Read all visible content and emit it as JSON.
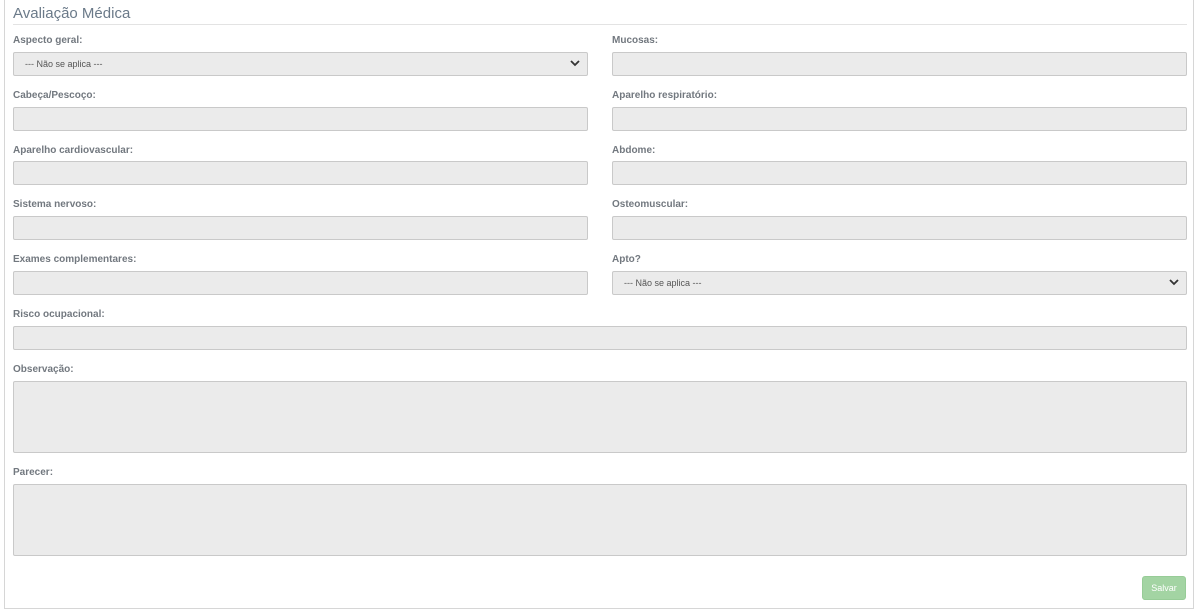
{
  "form": {
    "title": "Avaliação Médica",
    "fields": {
      "aspecto_geral": {
        "label": "Aspecto geral:",
        "value": "--- Não se aplica ---"
      },
      "mucosas": {
        "label": "Mucosas:",
        "value": ""
      },
      "cabeca_pescoco": {
        "label": "Cabeça/Pescoço:",
        "value": ""
      },
      "aparelho_respiratorio": {
        "label": "Aparelho respiratório:",
        "value": ""
      },
      "aparelho_cardiovascular": {
        "label": "Aparelho cardiovascular:",
        "value": ""
      },
      "abdome": {
        "label": "Abdome:",
        "value": ""
      },
      "sistema_nervoso": {
        "label": "Sistema nervoso:",
        "value": ""
      },
      "osteomuscular": {
        "label": "Osteomuscular:",
        "value": ""
      },
      "exames_complementares": {
        "label": "Exames complementares:",
        "value": ""
      },
      "apto": {
        "label": "Apto?",
        "value": "--- Não se aplica ---"
      },
      "risco_ocupacional": {
        "label": "Risco ocupacional:",
        "value": ""
      },
      "observacao": {
        "label": "Observação:",
        "value": ""
      },
      "parecer": {
        "label": "Parecer:",
        "value": ""
      }
    },
    "save_label": "Salvar"
  },
  "colors": {
    "field_bg": "#ebebeb",
    "label": "#72787f",
    "save_button": "#a3d4a3"
  }
}
